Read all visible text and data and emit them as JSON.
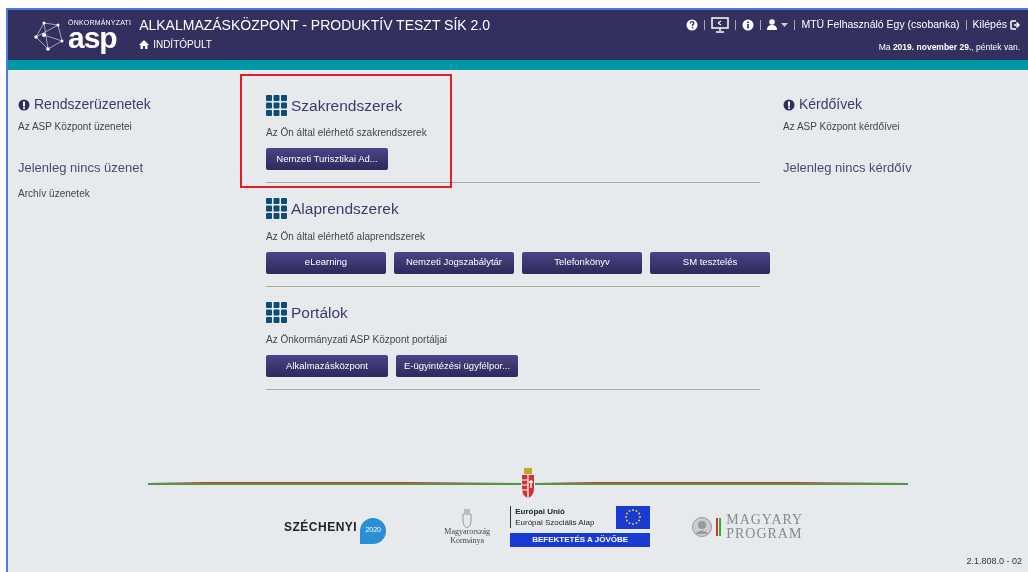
{
  "header": {
    "logo_small": "ÖNKORMÁNYZATI",
    "logo_large": "asp",
    "title": "ALKALMAZÁSKÖZPONT - PRODUKTÍV TESZT SÍK 2.0",
    "breadcrumb": "INDÍTÓPULT",
    "username": "MTÜ Felhasználó Egy (csobanka)",
    "logout": "Kilépés",
    "date": "Ma **2019. november 29.**, péntek van."
  },
  "left_panel": {
    "heading": "Rendszerüzenetek",
    "subtitle": "Az ASP Központ üzenetei",
    "empty_text": "Jelenleg nincs üzenet",
    "link": "Archív üzenetek"
  },
  "sections": [
    {
      "heading": "Szakrendszerek",
      "description": "Az Ön által elérhető szakrendszerek",
      "highlighted": true,
      "buttons": [
        "Nemzeti Turisztikai Ad..."
      ]
    },
    {
      "heading": "Alaprendszerek",
      "description": "Az Ön által elérhető alaprendszerek",
      "highlighted": false,
      "buttons": [
        "eLearning",
        "Nemzeti Jogszabálytár",
        "Telefonkönyv",
        "SM tesztelés"
      ]
    },
    {
      "heading": "Portálok",
      "description": "Az Önkormányzati ASP Központ portáljai",
      "highlighted": false,
      "buttons": [
        "Alkalmazásközpont",
        "E-ügyintézési ügyfélpor..."
      ]
    }
  ],
  "right_panel": {
    "heading": "Kérdőívek",
    "subtitle": "Az ASP Központ kérdőívei",
    "empty_text": "Jelenleg nincs kérdőív"
  },
  "footer": {
    "szechenyi": "SZÉCHENYI",
    "szechenyi_year": "2020",
    "government": "Magyarország Kormánya",
    "eu_title": "Európai Unió",
    "eu_fund": "Európai Szociális Alap",
    "eu_slogan": "BEFEKTETÉS A JÖVŐBE",
    "magyary": "MAGYARY PROGRAM",
    "version": "2.1.808.0 - 02"
  }
}
